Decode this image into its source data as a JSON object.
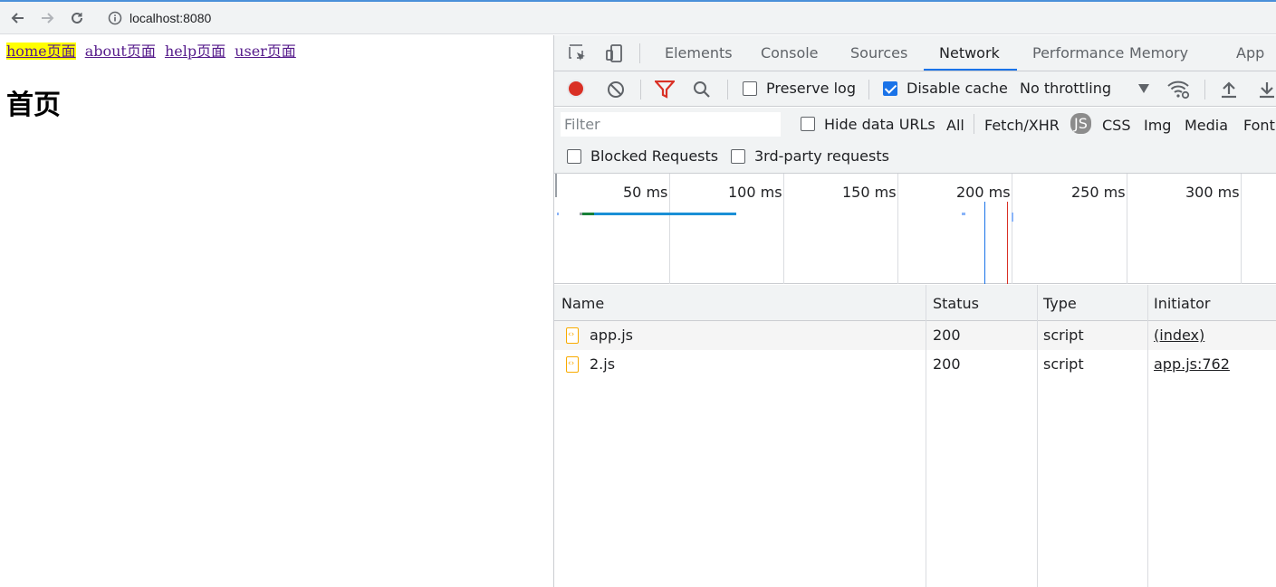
{
  "browser": {
    "url": "localhost:8080"
  },
  "page": {
    "nav_links": [
      {
        "label": "home页面",
        "active": true
      },
      {
        "label": "about页面",
        "active": false
      },
      {
        "label": "help页面",
        "active": false
      },
      {
        "label": "user页面",
        "active": false
      }
    ],
    "heading": "首页"
  },
  "devtools": {
    "tabs": [
      "Elements",
      "Console",
      "Sources",
      "Network",
      "Performance",
      "Memory",
      "App"
    ],
    "active_tab": "Network",
    "toolbar": {
      "preserve_log": "Preserve log",
      "disable_cache": "Disable cache",
      "throttling": "No throttling"
    },
    "filter": {
      "placeholder": "Filter",
      "hide_data_urls": "Hide data URLs",
      "types": [
        "All",
        "Fetch/XHR",
        "JS",
        "CSS",
        "Img",
        "Media",
        "Font"
      ],
      "active_type": "JS",
      "blocked_requests": "Blocked Requests",
      "third_party": "3rd-party requests"
    },
    "timeline": {
      "ticks": [
        "50 ms",
        "100 ms",
        "150 ms",
        "200 ms",
        "250 ms",
        "300 ms"
      ]
    },
    "table": {
      "headers": [
        "Name",
        "Status",
        "Type",
        "Initiator"
      ],
      "rows": [
        {
          "name": "app.js",
          "status": "200",
          "type": "script",
          "initiator": "(index)"
        },
        {
          "name": "2.js",
          "status": "200",
          "type": "script",
          "initiator": "app.js:762"
        }
      ]
    },
    "colors": {
      "accent": "#1a73e8",
      "record": "#d93025",
      "filter_icon": "#d93025",
      "file_icon": "#f9ab00"
    }
  }
}
